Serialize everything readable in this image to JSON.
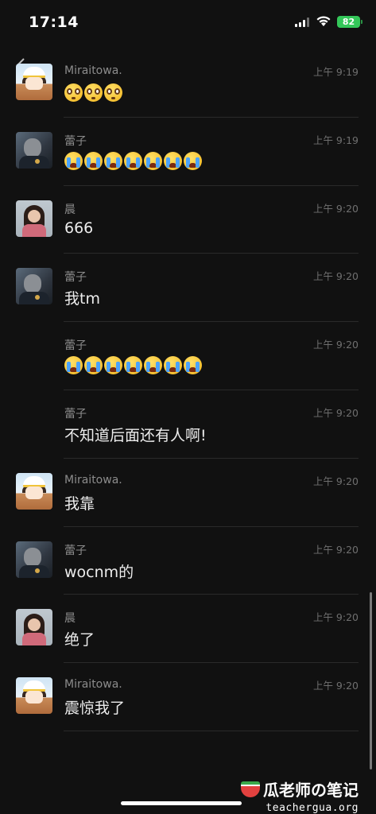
{
  "status_bar": {
    "time": "17:14",
    "battery": "82"
  },
  "messages": [
    {
      "sender": "Miraitowa.",
      "time": "上午 9:19",
      "type": "emoji",
      "emoji": "shocked",
      "count": 3,
      "avatar": "mirai"
    },
    {
      "sender": "蕾子",
      "time": "上午 9:19",
      "type": "emoji",
      "emoji": "crying",
      "count": 7,
      "avatar": "leizi"
    },
    {
      "sender": "晨",
      "time": "上午 9:20",
      "type": "text",
      "text": "666",
      "avatar": "chen"
    },
    {
      "sender": "蕾子",
      "time": "上午 9:20",
      "type": "text",
      "text": "我tm",
      "avatar": "leizi"
    },
    {
      "sender": "蕾子",
      "time": "上午 9:20",
      "type": "emoji",
      "emoji": "crying",
      "count": 7,
      "avatar": null
    },
    {
      "sender": "蕾子",
      "time": "上午 9:20",
      "type": "text",
      "text": "不知道后面还有人啊!",
      "avatar": null
    },
    {
      "sender": "Miraitowa.",
      "time": "上午 9:20",
      "type": "text",
      "text": "我靠",
      "avatar": "mirai"
    },
    {
      "sender": "蕾子",
      "time": "上午 9:20",
      "type": "text",
      "text": "wocnm的",
      "avatar": "leizi"
    },
    {
      "sender": "晨",
      "time": "上午 9:20",
      "type": "text",
      "text": "绝了",
      "avatar": "chen"
    },
    {
      "sender": "Miraitowa.",
      "time": "上午 9:20",
      "type": "text",
      "text": "震惊我了",
      "avatar": "mirai"
    }
  ],
  "watermark": {
    "title": "瓜老师の笔记",
    "url": "teachergua.org"
  }
}
